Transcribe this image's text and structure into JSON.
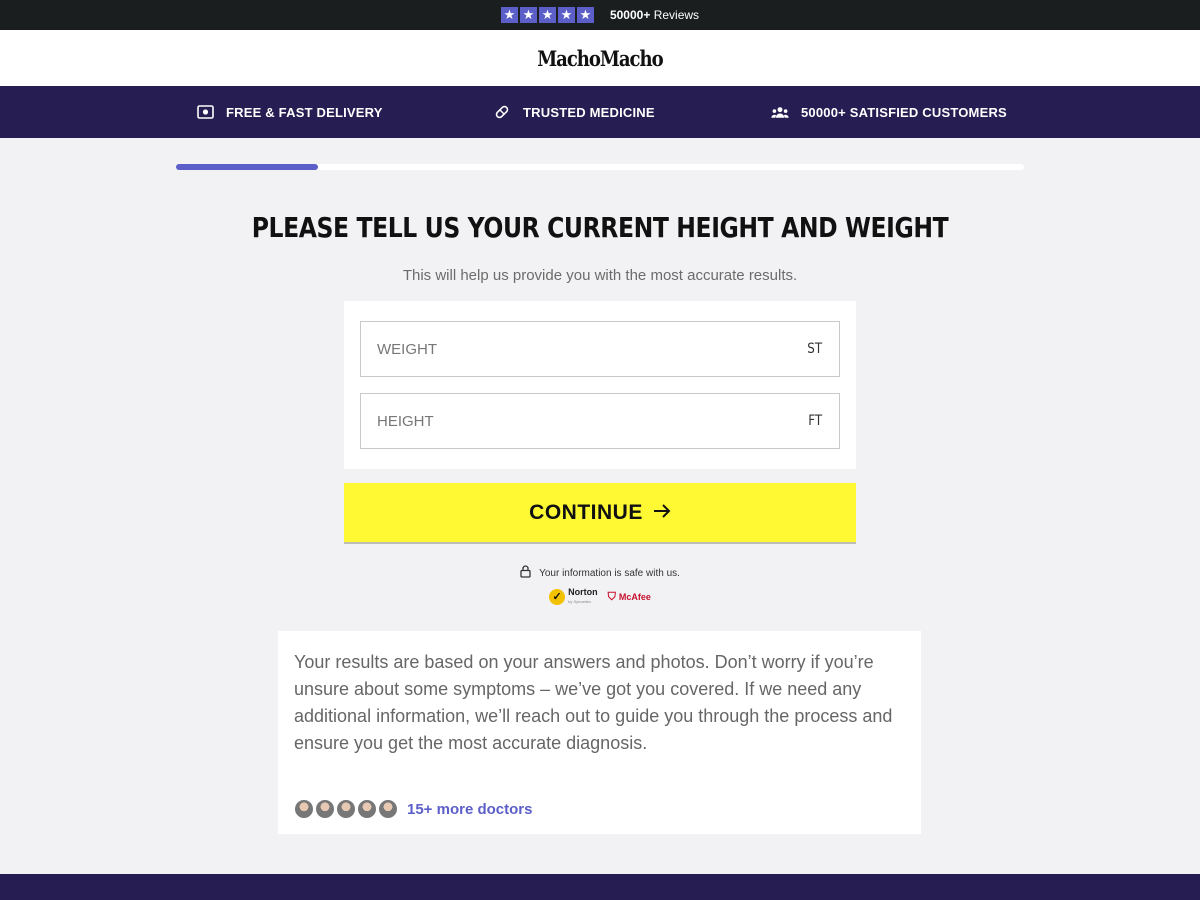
{
  "reviews": {
    "star_count": 5,
    "rating": 5,
    "count_text": "50000+",
    "label": "Reviews"
  },
  "brand": {
    "name": "MachoMacho"
  },
  "features": [
    {
      "icon": "cash-icon",
      "label": "FREE & FAST DELIVERY"
    },
    {
      "icon": "pill-icon",
      "label": "TRUSTED MEDICINE"
    },
    {
      "icon": "people-icon",
      "label": "50000+ SATISFIED CUSTOMERS"
    }
  ],
  "progress": {
    "fraction": 0.167
  },
  "question": {
    "title": "PLEASE TELL US YOUR CURRENT HEIGHT AND WEIGHT",
    "subtitle": "This will help us provide you with the most accurate results."
  },
  "form": {
    "weight": {
      "placeholder": "WEIGHT",
      "value": "",
      "unit": "ST"
    },
    "height": {
      "placeholder": "HEIGHT",
      "value": "",
      "unit": "FT"
    }
  },
  "continue_button": {
    "label": "CONTINUE"
  },
  "security": {
    "text": "Your information is safe with us.",
    "badges": {
      "norton": "Norton",
      "norton_sub": "by Symantec",
      "mcafee": "McAfee"
    }
  },
  "info": {
    "text": "Your results are based on your answers and photos. Don’t worry if you’re unsure about some symptoms – we’ve got you covered. If we need any additional information, we’ll reach out to guide you through the process and ensure you get the most accurate diagnosis.",
    "doctors_link": "15+ more doctors",
    "avatar_count": 5
  },
  "colors": {
    "accent": "#5b5fc7",
    "nav_bg": "#261d52",
    "top_bar_bg": "#1b1e1e",
    "button_bg": "#fff934",
    "page_bg": "#f2f2f4"
  }
}
